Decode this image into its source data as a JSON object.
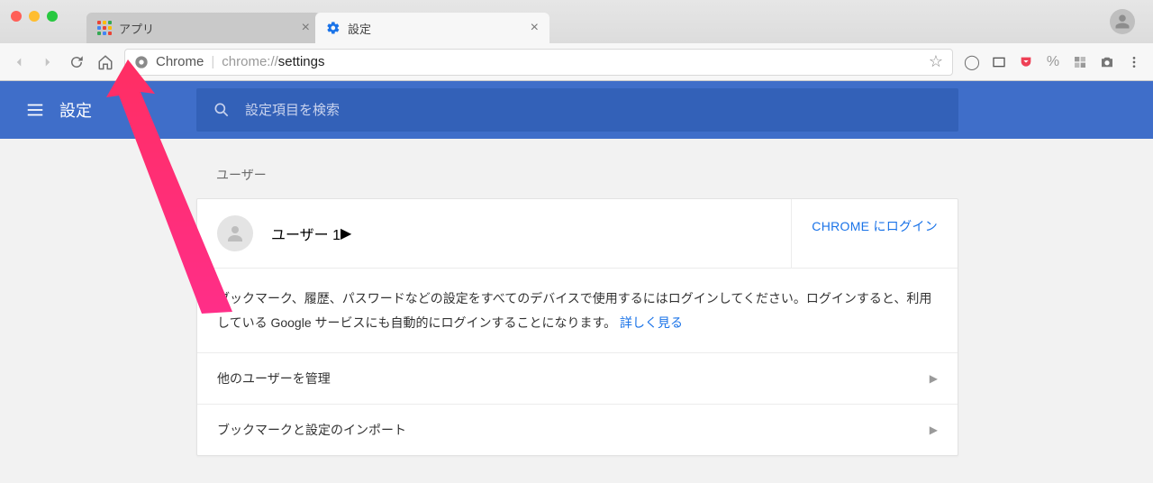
{
  "window": {
    "tabs": [
      {
        "title": "アプリ",
        "active": false
      },
      {
        "title": "設定",
        "active": true
      }
    ]
  },
  "addressbar": {
    "chip": "Chrome",
    "url_prefix": "chrome://",
    "url_path": "settings"
  },
  "header": {
    "title": "設定",
    "search_placeholder": "設定項目を検索"
  },
  "users_section": {
    "label": "ユーザー",
    "current_user": "ユーザー 1",
    "login_button": "CHROME にログイン",
    "description": "ブックマーク、履歴、パスワードなどの設定をすべてのデバイスで使用するにはログインしてください。ログインすると、利用している Google サービスにも自動的にログインすることになります。",
    "learn_more": "詳しく見る",
    "manage_others": "他のユーザーを管理",
    "import": "ブックマークと設定のインポート"
  }
}
